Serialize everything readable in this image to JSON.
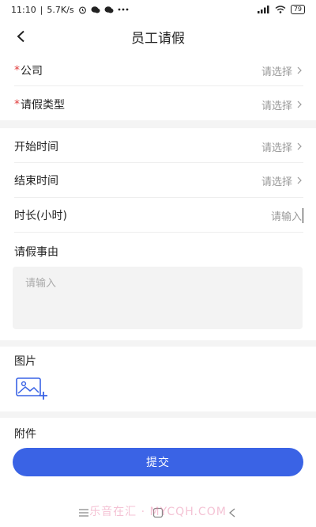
{
  "status_bar": {
    "time": "11:10",
    "speed": "5.7K/s",
    "battery": "79"
  },
  "header": {
    "title": "员工请假"
  },
  "form": {
    "company": {
      "required_mark": "*",
      "label": "公司",
      "value": "请选择"
    },
    "leave_type": {
      "required_mark": "*",
      "label": "请假类型",
      "value": "请选择"
    },
    "start_time": {
      "label": "开始时间",
      "value": "请选择"
    },
    "end_time": {
      "label": "结束时间",
      "value": "请选择"
    },
    "duration": {
      "label": "时长(小时)",
      "placeholder": "请输入"
    },
    "reason": {
      "label": "请假事由",
      "placeholder": "请输入"
    },
    "images": {
      "label": "图片"
    },
    "attachments": {
      "label": "附件"
    }
  },
  "actions": {
    "submit_label": "提交"
  },
  "watermark": "乐音在汇 · MYCQH.COM",
  "colors": {
    "primary": "#3a63e5",
    "required": "#e03a3a",
    "placeholder": "#999999",
    "band": "#f4f4f4"
  }
}
